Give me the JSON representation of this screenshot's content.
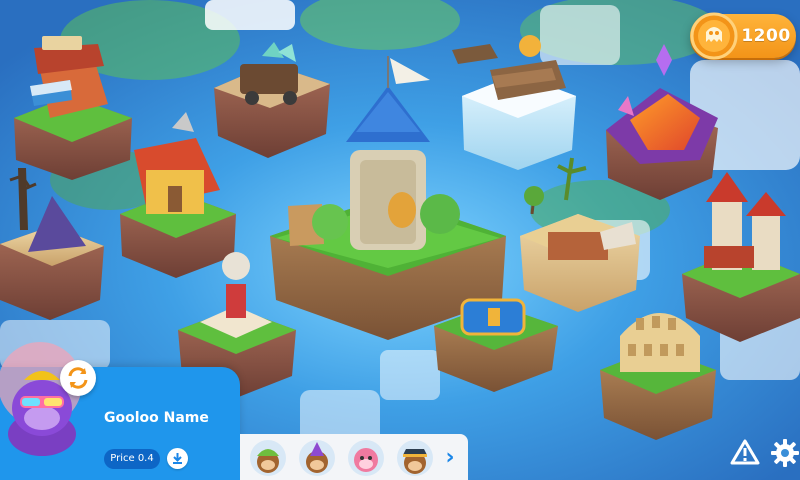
{
  "wallet": {
    "coins": "1200",
    "icon": "coin-ghost-icon"
  },
  "profile": {
    "name": "Gooloo Name",
    "price": "Price 0.4",
    "avatar": "purple-gorilla-avatar",
    "swap_icon": "swap-arrows-icon",
    "download_icon": "download-icon"
  },
  "characters": [
    {
      "name": "monkey-green-hat",
      "color": "#6fbe3e"
    },
    {
      "name": "monkey-purple-hat",
      "color": "#8d4ad0"
    },
    {
      "name": "monkey-pink",
      "color": "#f07aa0"
    },
    {
      "name": "monkey-captain",
      "color": "#2c3e50"
    }
  ],
  "nav": {
    "next_icon": "chevron-right-icon"
  },
  "corner_actions": {
    "warning_icon": "warning-icon",
    "settings_icon": "gear-icon"
  },
  "islands": [
    "market-island",
    "mine-cart-island",
    "castle-tower-island",
    "ice-island",
    "lava-crystal-island",
    "lumberjack-house-island",
    "bamboo-tree-island",
    "statue-island",
    "treasure-chest-island",
    "tropical-ruins-island",
    "red-towers-island",
    "colosseum-island"
  ],
  "colors": {
    "water": "#3a8fd8",
    "panel": "#1f96ec",
    "coin": "#f7a324",
    "accent": "#1a86e8"
  }
}
